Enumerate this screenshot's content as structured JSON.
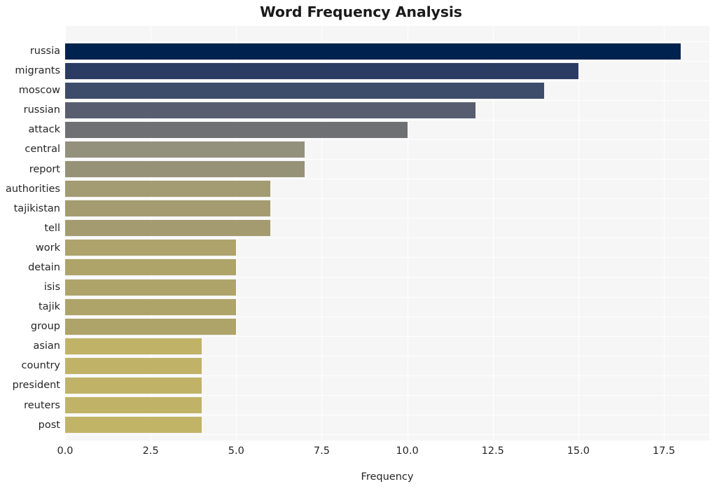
{
  "chart_data": {
    "type": "bar",
    "orientation": "horizontal",
    "title": "Word Frequency Analysis",
    "xlabel": "Frequency",
    "ylabel": "",
    "categories": [
      "russia",
      "migrants",
      "moscow",
      "russian",
      "attack",
      "central",
      "report",
      "authorities",
      "tajikistan",
      "tell",
      "work",
      "detain",
      "isis",
      "tajik",
      "group",
      "asian",
      "country",
      "president",
      "reuters",
      "post"
    ],
    "values": [
      18,
      15,
      14,
      12,
      10,
      7,
      7,
      6,
      6,
      6,
      5,
      5,
      5,
      5,
      5,
      4,
      4,
      4,
      4,
      4
    ],
    "bar_colors": [
      "#00224e",
      "#2b3c63",
      "#3e4c6b",
      "#585e6f",
      "#6f7073",
      "#93907c",
      "#969277",
      "#a39b71",
      "#a49c70",
      "#a49c70",
      "#ada36b",
      "#aea46a",
      "#aea46a",
      "#aea46a",
      "#aea46a",
      "#c0b367",
      "#c0b367",
      "#c0b367",
      "#c0b367",
      "#c1b466"
    ],
    "xlim": [
      0,
      18.83
    ],
    "x_ticks": [
      0.0,
      2.5,
      5.0,
      7.5,
      10.0,
      12.5,
      15.0,
      17.5
    ],
    "x_tick_labels": [
      "0.0",
      "2.5",
      "5.0",
      "7.5",
      "10.0",
      "12.5",
      "15.0",
      "17.5"
    ],
    "grid": true,
    "grid_color": "#ffffff",
    "plot_background": "#f6f6f7",
    "figure_background": "#ffffff",
    "legend": null,
    "legend_position": "none"
  }
}
